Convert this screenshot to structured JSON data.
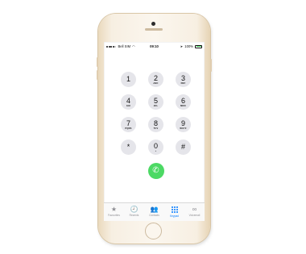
{
  "status_bar": {
    "carrier": "Bell SIM",
    "time": "09:10",
    "battery_percent": 100,
    "battery_level": 0.95
  },
  "keypad": {
    "keys": [
      {
        "digit": "1",
        "letters": ""
      },
      {
        "digit": "2",
        "letters": "ABC"
      },
      {
        "digit": "3",
        "letters": "DEF"
      },
      {
        "digit": "4",
        "letters": "GHI"
      },
      {
        "digit": "5",
        "letters": "JKL"
      },
      {
        "digit": "6",
        "letters": "MNO"
      },
      {
        "digit": "7",
        "letters": "PQRS"
      },
      {
        "digit": "8",
        "letters": "TUV"
      },
      {
        "digit": "9",
        "letters": "WXYZ"
      },
      {
        "digit": "*",
        "letters": ""
      },
      {
        "digit": "0",
        "letters": "+"
      },
      {
        "digit": "#",
        "letters": ""
      }
    ],
    "call_icon": "phone-icon"
  },
  "tabs": [
    {
      "label": "Favourites",
      "icon": "star-icon",
      "glyph": "★",
      "active": false
    },
    {
      "label": "Recents",
      "icon": "clock-icon",
      "glyph": "🕘",
      "active": false
    },
    {
      "label": "Contacts",
      "icon": "contacts-icon",
      "glyph": "👥",
      "active": false
    },
    {
      "label": "Keypad",
      "icon": "keypad-icon",
      "glyph": "",
      "active": true
    },
    {
      "label": "Voicemail",
      "icon": "voicemail-icon",
      "glyph": "∞",
      "active": false
    }
  ],
  "colors": {
    "accent": "#007aff",
    "call": "#4cd964",
    "key_background": "#e5e5ea",
    "phone_body": "#f7efe2"
  }
}
